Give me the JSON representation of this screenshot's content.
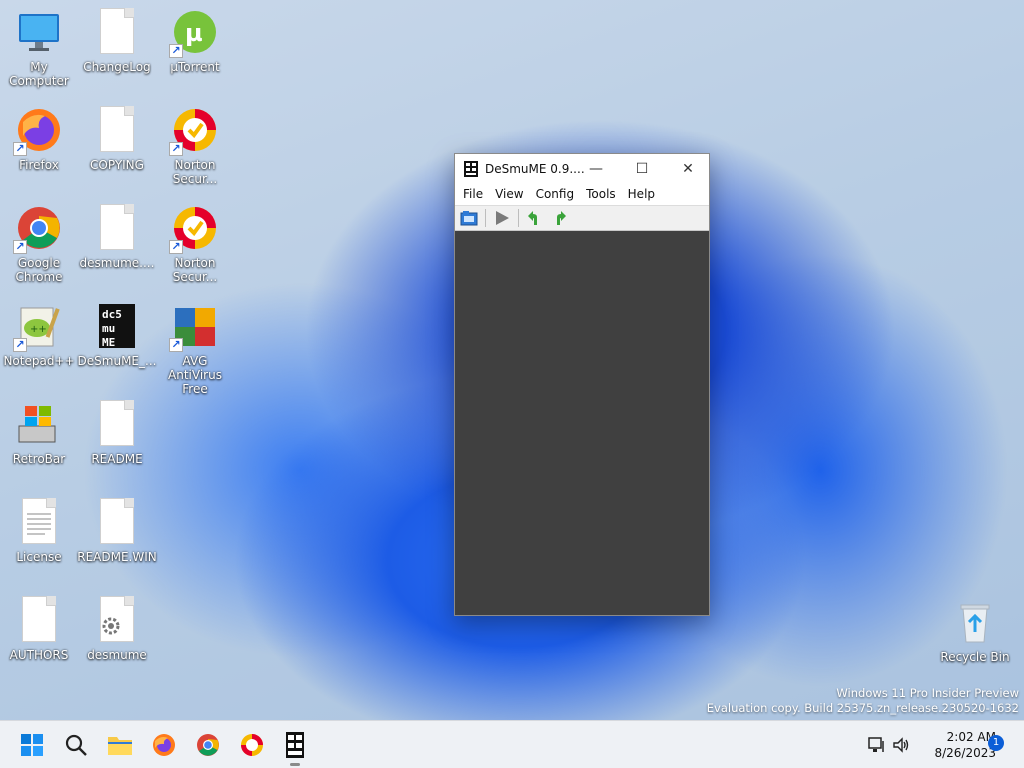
{
  "desktop": {
    "icons": [
      {
        "label": "My Computer",
        "icon": "monitor-icon"
      },
      {
        "label": "ChangeLog",
        "icon": "document-icon"
      },
      {
        "label": "µTorrent",
        "icon": "utorrent-icon"
      },
      {
        "label": "Firefox",
        "icon": "firefox-icon"
      },
      {
        "label": "COPYING",
        "icon": "document-icon"
      },
      {
        "label": "Norton Secur...",
        "icon": "norton-icon"
      },
      {
        "label": "Google Chrome",
        "icon": "chrome-icon"
      },
      {
        "label": "desmume....",
        "icon": "document-icon"
      },
      {
        "label": "Norton Secur...",
        "icon": "norton-icon"
      },
      {
        "label": "Notepad++",
        "icon": "notepad-plus-plus-icon"
      },
      {
        "label": "DeSmuME_...",
        "icon": "desmume-icon"
      },
      {
        "label": "AVG AntiVirus Free",
        "icon": "avg-icon"
      },
      {
        "label": "RetroBar",
        "icon": "retrobar-icon"
      },
      {
        "label": "README",
        "icon": "document-icon"
      },
      {
        "label": "License",
        "icon": "text-document-icon"
      },
      {
        "label": "README.WIN",
        "icon": "document-icon"
      },
      {
        "label": "AUTHORS",
        "icon": "document-icon"
      },
      {
        "label": "desmume",
        "icon": "settings-file-icon"
      },
      {
        "label": "Recycle Bin",
        "icon": "recycle-bin-icon"
      }
    ],
    "watermark": {
      "line1": "Windows 11 Pro Insider Preview",
      "line2": "Evaluation copy. Build 25375.zn_release.230520-1632"
    }
  },
  "window": {
    "title": "DeSmuME 0.9....",
    "controls": {
      "minimize": "—",
      "maximize": "☐",
      "close": "✕"
    },
    "menu": [
      "File",
      "View",
      "Config",
      "Tools",
      "Help"
    ],
    "toolbar": [
      "open-rom-icon",
      "play-icon",
      "rotate-left-icon",
      "rotate-right-icon"
    ]
  },
  "taskbar": {
    "pinned": [
      "start-icon",
      "search-icon",
      "file-explorer-icon",
      "firefox-icon",
      "chrome-icon",
      "norton-icon",
      "desmume-icon"
    ],
    "clock": {
      "time": "2:02 AM",
      "date": "8/26/2023"
    },
    "notification_count": "1"
  }
}
